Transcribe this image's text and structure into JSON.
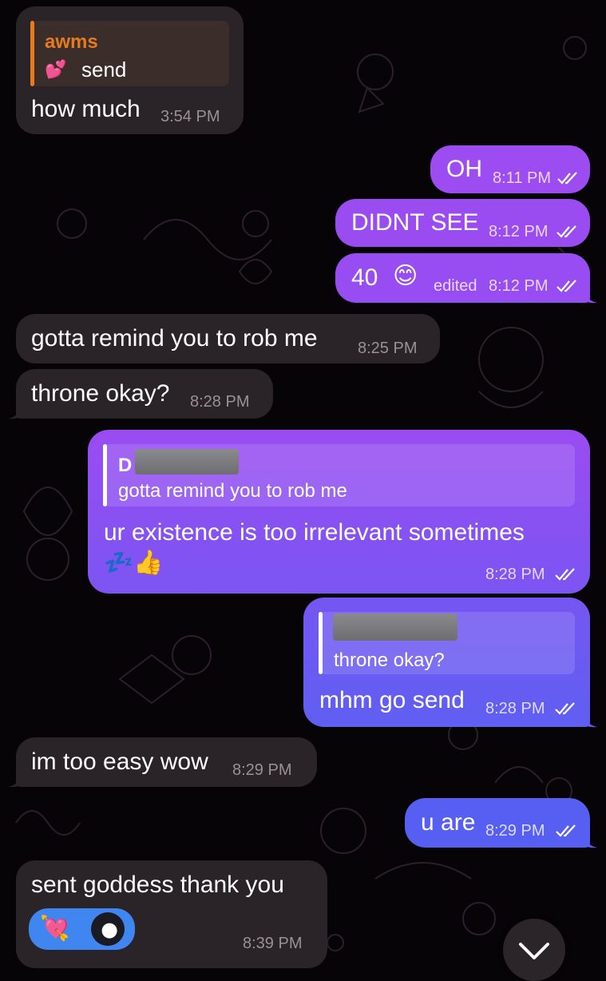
{
  "colors": {
    "incoming_bubble": "#2a2327",
    "outgoing_top": "#a04df0",
    "outgoing_bottom": "#5b5ef2",
    "reply_accent_incoming": "#e57a1e",
    "background": "#060407"
  },
  "messages": {
    "m1": {
      "reply_author": "awms",
      "reply_emoji": "💕",
      "reply_text": "send",
      "text": "how much",
      "time": "3:54 PM"
    },
    "m2": {
      "text": "OH",
      "time": "8:11 PM",
      "status_icon": "double-check-icon"
    },
    "m3": {
      "text": "DIDNT SEE",
      "time": "8:12 PM",
      "status_icon": "double-check-icon"
    },
    "m4": {
      "text": "40",
      "emoji": "😊",
      "edited_label": "edited",
      "time": "8:12 PM",
      "status_icon": "double-check-icon"
    },
    "m5": {
      "text": "gotta remind you to rob me",
      "time": "8:25 PM"
    },
    "m6": {
      "text": "throne okay?",
      "time": "8:28 PM"
    },
    "m7": {
      "reply_author_initial": "D",
      "reply_text": "gotta remind you to rob me",
      "text": "ur existence is too irrelevant sometimes",
      "emoji": "💤👍",
      "time": "8:28 PM",
      "status_icon": "double-check-icon"
    },
    "m8": {
      "reply_text": "throne okay?",
      "text": "mhm go send",
      "time": "8:28 PM",
      "status_icon": "double-check-icon"
    },
    "m9": {
      "text": "im too easy wow",
      "time": "8:29 PM"
    },
    "m10": {
      "text": "u are",
      "time": "8:29 PM",
      "status_icon": "double-check-icon"
    },
    "m11": {
      "text": "sent goddess thank you",
      "reaction_emoji": "💘",
      "time": "8:39 PM"
    }
  },
  "scroll_button": {
    "icon": "chevron-down-icon"
  }
}
